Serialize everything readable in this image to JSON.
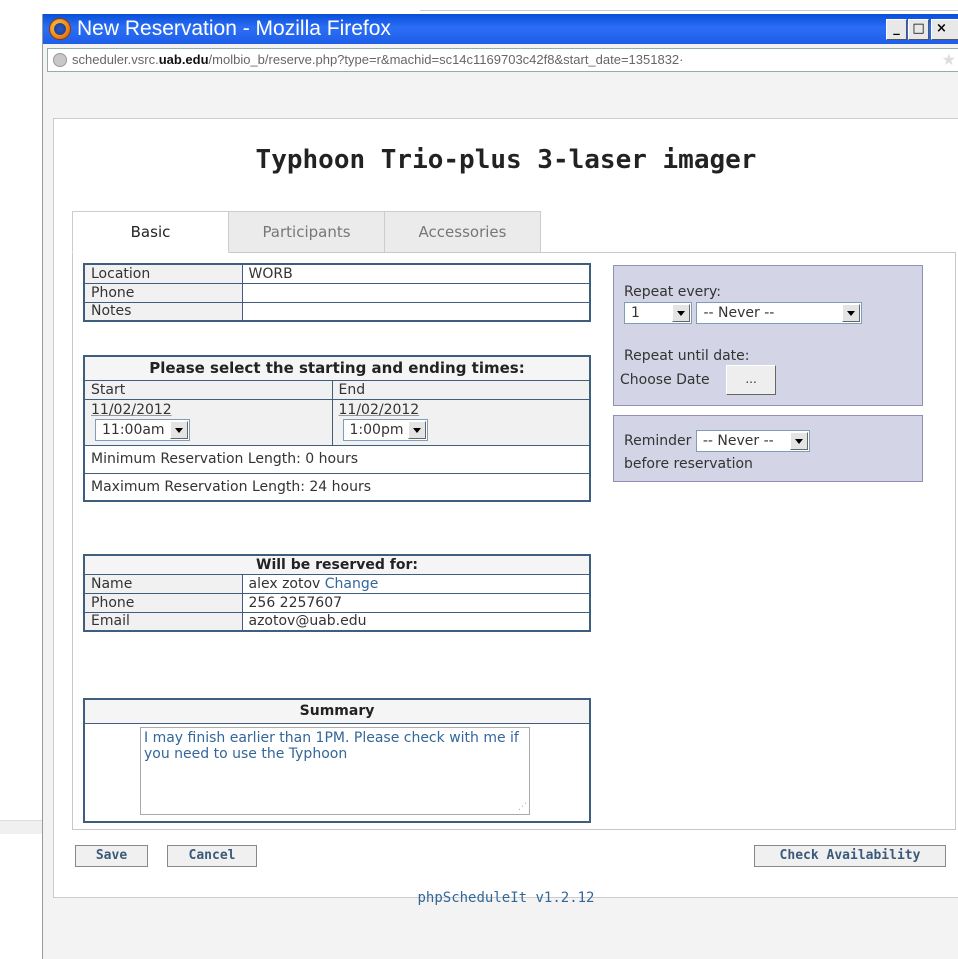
{
  "window": {
    "title": "New Reservation - Mozilla Firefox",
    "url_prefix": "scheduler.vsrc.",
    "url_domain": "uab.edu",
    "url_suffix": "/molbio_b/reserve.php?type=r&machid=sc14c1169703c42f8&start_date=1351832·",
    "min_label": "_",
    "max_label": "□",
    "close_label": "×"
  },
  "page": {
    "title": "Typhoon Trio-plus 3-laser imager",
    "footer": "phpScheduleIt v1.2.12"
  },
  "tabs": [
    {
      "label": "Basic",
      "active": true
    },
    {
      "label": "Participants",
      "active": false
    },
    {
      "label": "Accessories",
      "active": false
    }
  ],
  "location_info": {
    "location_label": "Location",
    "location_value": "WORB",
    "phone_label": "Phone",
    "phone_value": "",
    "notes_label": "Notes",
    "notes_value": ""
  },
  "times": {
    "heading": "Please select the starting and ending times:",
    "start_label": "Start",
    "end_label": "End",
    "start_date": "11/02/2012",
    "end_date": "11/02/2012",
    "start_time": "11:00am",
    "end_time": "1:00pm",
    "min_length": "Minimum Reservation Length: 0 hours",
    "max_length": "Maximum Reservation Length: 24 hours"
  },
  "reserved_for": {
    "heading": "Will be reserved for:",
    "name_label": "Name",
    "name_value": "alex zotov",
    "change_link": "Change",
    "phone_label": "Phone",
    "phone_value": "256 2257607",
    "email_label": "Email",
    "email_value": "azotov@uab.edu"
  },
  "summary": {
    "heading": "Summary",
    "text": "I may finish earlier than 1PM. Please check with me if you need to use the Typhoon"
  },
  "repeat": {
    "every_label": "Repeat every:",
    "every_count": "1",
    "every_interval": "-- Never --",
    "until_label": "Repeat until date:",
    "choose_label": "Choose Date",
    "choose_button": "..."
  },
  "reminder": {
    "label": "Reminder",
    "value": "-- Never --",
    "suffix": "before reservation"
  },
  "actions": {
    "save": "Save",
    "cancel": "Cancel",
    "check": "Check Availability"
  }
}
